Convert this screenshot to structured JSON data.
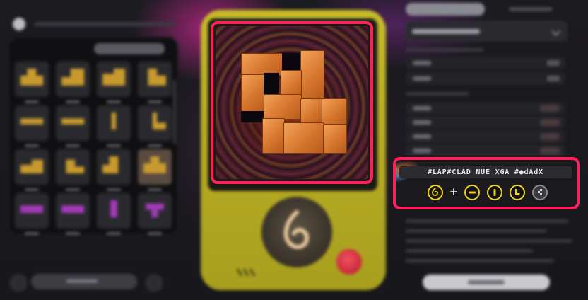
{
  "app": {
    "device": {
      "body_color": "#c0b52a",
      "accent_color": "#ff1f5a"
    },
    "left": {
      "tabs": [
        "",
        ""
      ],
      "tiles": [
        {
          "color": "#c89a2e"
        },
        {
          "color": "#c89a2e"
        },
        {
          "color": "#c89a2e"
        },
        {
          "color": "#c89a2e"
        },
        {
          "color": "#c89a2e"
        },
        {
          "color": "#c89a2e"
        },
        {
          "color": "#c89a2e"
        },
        {
          "color": "#c89a2e"
        },
        {
          "color": "#c89a2e"
        },
        {
          "color": "#c89a2e"
        },
        {
          "color": "#c89a2e"
        },
        {
          "color": "#c89a2e"
        },
        {
          "color": "#a23ab8"
        },
        {
          "color": "#a23ab8"
        },
        {
          "color": "#a23ab8"
        },
        {
          "color": "#a23ab8"
        }
      ]
    },
    "controls": {
      "code_text": "#LAP#CLAD NUE XGA #●dAdX",
      "moves": [
        {
          "name": "spiral-icon"
        },
        {
          "name": "horizontal-bar-icon"
        },
        {
          "name": "vertical-bar-icon"
        },
        {
          "name": "l-shape-icon"
        },
        {
          "name": "diagonal-blocks-icon"
        }
      ],
      "plus": "+"
    }
  }
}
